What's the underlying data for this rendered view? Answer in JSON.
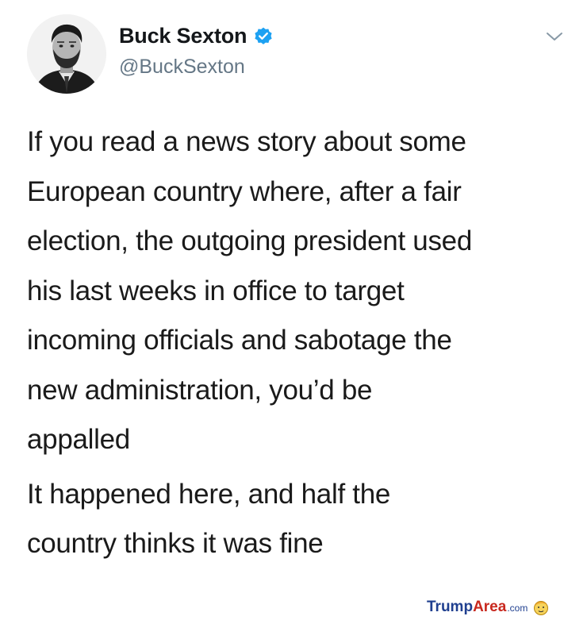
{
  "author": {
    "display_name": "Buck Sexton",
    "handle": "@BuckSexton",
    "verified": true
  },
  "tweet": {
    "paragraphs": [
      [
        "If you read a news story about some",
        "European country where, after a fair",
        "election, the outgoing president used",
        "his last weeks in office to target",
        "incoming officials and sabotage the",
        "new administration, you’d be",
        "appalled"
      ],
      [
        "It happened here, and half the",
        "country thinks it was fine"
      ]
    ]
  },
  "icons": {
    "avatar": "profile-photo",
    "verified": "verified-badge-icon",
    "menu": "chevron-down-icon",
    "watermark": "cartoon-face-logo"
  },
  "watermark": {
    "part1": "Trump",
    "part2": "Area",
    "part3": ".com"
  },
  "colors": {
    "verified_blue": "#1da1f2",
    "handle_gray": "#657786",
    "text": "#14171a",
    "watermark_blue": "#1f3f8f",
    "watermark_red": "#c8281e"
  }
}
